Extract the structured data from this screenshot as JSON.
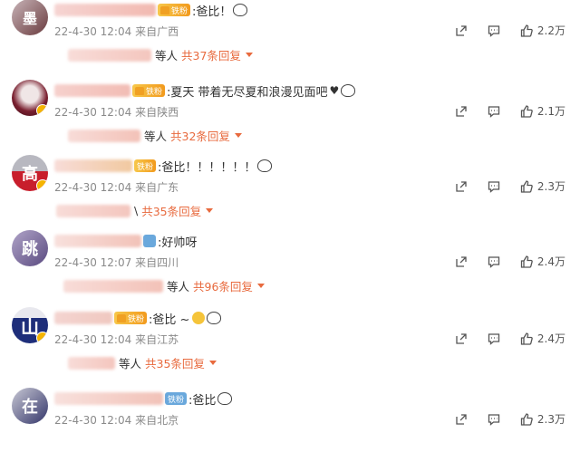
{
  "comments": [
    {
      "badge": "铁粉",
      "text": ":爸比！",
      "time": "22-4-30 12:04",
      "location": "来自广西",
      "likes": "2.2万",
      "reply_suffix": "等人",
      "reply_count": "共37条回复"
    },
    {
      "badge": "铁粉",
      "text": ":夏天  带着无尽夏和浪漫见面吧",
      "time": "22-4-30 12:04",
      "location": "来自陕西",
      "likes": "2.1万",
      "reply_suffix": "等人",
      "reply_count": "共32条回复"
    },
    {
      "badge": "铁粉",
      "text": ":爸比！！！！！！",
      "time": "22-4-30 12:04",
      "location": "来自广东",
      "likes": "2.3万",
      "reply_suffix": "\\",
      "reply_count": "共35条回复"
    },
    {
      "badge": "",
      "text": ":好帅呀",
      "time": "22-4-30 12:07",
      "location": "来自四川",
      "likes": "2.4万",
      "reply_suffix": "等人",
      "reply_count": "共96条回复"
    },
    {
      "badge": "铁粉",
      "text": ":爸比 ~",
      "time": "22-4-30 12:04",
      "location": "来自江苏",
      "likes": "2.4万",
      "reply_suffix": "等人",
      "reply_count": "共35条回复"
    },
    {
      "badge": "铁粉",
      "text": ":爸比",
      "time": "22-4-30 12:04",
      "location": "来自北京",
      "likes": "2.3万",
      "reply_suffix": "",
      "reply_count": ""
    }
  ],
  "icons": {
    "share": "share-icon",
    "comment": "comment-icon",
    "like": "like-icon"
  },
  "colors": {
    "reply_accent": "#e86a3e",
    "meta": "#8a8a8a",
    "badge_fan": "#f29a1d",
    "badge_iron": "#6aa8dc"
  }
}
